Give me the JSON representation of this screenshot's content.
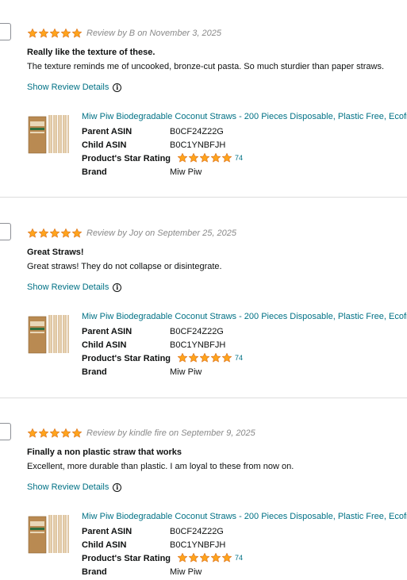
{
  "colors": {
    "star_fill": "#ffa41c",
    "star_stroke": "#de7921",
    "link": "#007185",
    "divider": "#dddddd"
  },
  "reviews": [
    {
      "rating": 5,
      "meta": "Review by B on November 3, 2025",
      "title": "Really like the texture of these.",
      "body": "The texture reminds me of uncooked, bronze-cut pasta. So much sturdier than paper straws.",
      "details_link": "Show Review Details",
      "product": {
        "title": "Miw Piw Biodegradable Coconut Straws - 200 Pieces Disposable, Plastic Free, Ecofriendly",
        "parent_asin_label": "Parent ASIN",
        "parent_asin": "B0CF24Z22G",
        "child_asin_label": "Child ASIN",
        "child_asin": "B0C1YNBFJH",
        "star_rating_label": "Product's Star Rating",
        "star_rating": 5,
        "rating_count": "74",
        "brand_label": "Brand",
        "brand": "Miw Piw"
      }
    },
    {
      "rating": 5,
      "meta": "Review by Joy on September 25, 2025",
      "title": "Great Straws!",
      "body": "Great straws! They do not collapse or disintegrate.",
      "details_link": "Show Review Details",
      "product": {
        "title": "Miw Piw Biodegradable Coconut Straws - 200 Pieces Disposable, Plastic Free, Ecofriendly",
        "parent_asin_label": "Parent ASIN",
        "parent_asin": "B0CF24Z22G",
        "child_asin_label": "Child ASIN",
        "child_asin": "B0C1YNBFJH",
        "star_rating_label": "Product's Star Rating",
        "star_rating": 5,
        "rating_count": "74",
        "brand_label": "Brand",
        "brand": "Miw Piw"
      }
    },
    {
      "rating": 5,
      "meta": "Review by kindle fire on September 9, 2025",
      "title": "Finally a non plastic straw that works",
      "body": "Excellent, more durable than plastic. I am loyal to these from now on.",
      "details_link": "Show Review Details",
      "product": {
        "title": "Miw Piw Biodegradable Coconut Straws - 200 Pieces Disposable, Plastic Free, Ecofriendly",
        "parent_asin_label": "Parent ASIN",
        "parent_asin": "B0CF24Z22G",
        "child_asin_label": "Child ASIN",
        "child_asin": "B0C1YNBFJH",
        "star_rating_label": "Product's Star Rating",
        "star_rating": 5,
        "rating_count": "74",
        "brand_label": "Brand",
        "brand": "Miw Piw"
      }
    }
  ]
}
